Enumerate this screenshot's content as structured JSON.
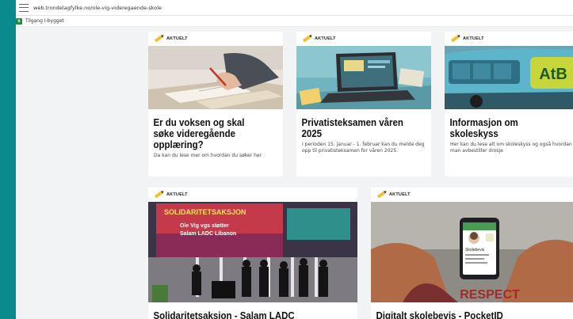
{
  "browser": {
    "url": "web.trondelagfylke.no/ole-vig-videregaende-skole",
    "bookmark_label": "Tilgang I-bygget",
    "bookmark_icon": "excel-icon"
  },
  "cards": [
    {
      "tag": "AKTUELT",
      "title": "Er du voksen og skal søke videregående opplæring?",
      "description": "Da kan du lese mer om hvordan du søker her",
      "image": "hand-writing-photo"
    },
    {
      "tag": "AKTUELT",
      "title": "Privatisteksamen våren 2025",
      "description": "I perioden 15. januar - 1. februar kan du melde deg opp til privatisteksamen for våren 2025.",
      "image": "laptop-desk-photo"
    },
    {
      "tag": "AKTUELT",
      "title": "Informasjon om skoleskyss",
      "description": "Her kan du lese alt om skoleskyss og også hvordan man avbestiller drosje",
      "image": "atb-bus-photo",
      "image_text": "AtB"
    },
    {
      "tag": "AKTUELT",
      "title": "Solidaritetsaksjon - Salam LADC",
      "image": "stage-event-photo",
      "image_text": [
        "SOLIDARITETSAKSJON",
        "Ole Vig vgs støtter",
        "Salam LADC Libanon"
      ]
    },
    {
      "tag": "AKTUELT",
      "title": "Digitalt skolebevis - PocketID",
      "image": "phone-id-photo",
      "image_text": [
        "Skolebevis",
        "RESPECT"
      ]
    }
  ],
  "colors": {
    "background": "#0a8a8c",
    "page": "#f1f3f4",
    "tag_icon": "#f2c12e"
  }
}
